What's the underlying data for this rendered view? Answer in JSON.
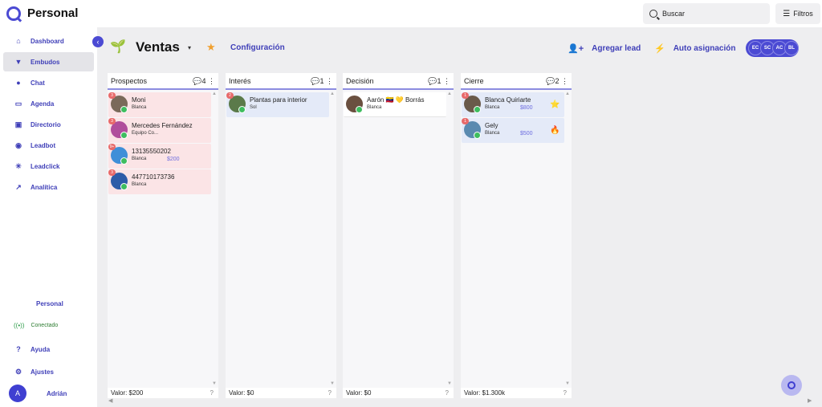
{
  "app": {
    "brand": "Personal",
    "search_label": "Buscar",
    "filters_label": "Filtros"
  },
  "sidebar": {
    "items": [
      {
        "label": "Dashboard",
        "icon": "home-icon"
      },
      {
        "label": "Embudos",
        "icon": "funnel-icon"
      },
      {
        "label": "Chat",
        "icon": "chat-icon"
      },
      {
        "label": "Agenda",
        "icon": "calendar-icon"
      },
      {
        "label": "Directorio",
        "icon": "contacts-icon"
      },
      {
        "label": "Leadbot",
        "icon": "bot-icon"
      },
      {
        "label": "Leadclick",
        "icon": "click-icon"
      },
      {
        "label": "Analítica",
        "icon": "trend-icon"
      }
    ],
    "workspace": "Personal",
    "status": "Conectado",
    "help": "Ayuda",
    "settings": "Ajustes",
    "user_initial": "A",
    "user_name": "Adrián"
  },
  "header": {
    "title": "Ventas",
    "config_label": "Configuración",
    "add_lead_label": "Agregar lead",
    "auto_assign_label": "Auto asignación",
    "agents": [
      "EC",
      "SC",
      "AC",
      "BL"
    ]
  },
  "columns": [
    {
      "name": "Prospectos",
      "count": "4",
      "total": "Valor: $200",
      "cards": [
        {
          "name": "Moni",
          "agent": "Blanca",
          "value": "",
          "badge": "3",
          "style": "pink",
          "avatar_color": "#7a6a5a"
        },
        {
          "name": "Mercedes Fernández",
          "agent": "Equipo Co...",
          "value": "",
          "badge": "3",
          "style": "pink",
          "avatar_color": "#b04e9c"
        },
        {
          "name": "13135550202",
          "agent": "Blanca",
          "value": "$200",
          "badge": "9+",
          "style": "pink",
          "avatar_color": "#3f8fd8"
        },
        {
          "name": "447710173736",
          "agent": "Blanca",
          "value": "",
          "badge": "3",
          "style": "pink",
          "avatar_color": "#2d5ca8"
        }
      ]
    },
    {
      "name": "Interés",
      "count": "1",
      "total": "Valor: $0",
      "cards": [
        {
          "name": "Plantas para interior",
          "agent": "Sol",
          "value": "",
          "badge": "2",
          "style": "blue",
          "avatar_color": "#5b7a4a"
        }
      ]
    },
    {
      "name": "Decisión",
      "count": "1",
      "total": "Valor: $0",
      "cards": [
        {
          "name": "Aarón 🇻🇪 💛 Borrás",
          "agent": "Blanca",
          "value": "",
          "badge": "",
          "style": "white",
          "avatar_color": "#6a5040"
        }
      ]
    },
    {
      "name": "Cierre",
      "count": "2",
      "total": "Valor: $1.300k",
      "cards": [
        {
          "name": "Blanca Quiriarte",
          "agent": "Blanca",
          "value": "$800",
          "badge": "1",
          "style": "blue",
          "avatar_color": "#6a5a4a",
          "extra": "⭐"
        },
        {
          "name": "Gely",
          "agent": "Blanca",
          "value": "$500",
          "badge": "1",
          "style": "blue",
          "avatar_color": "#5a8ab0",
          "extra": "🔥"
        }
      ]
    }
  ]
}
